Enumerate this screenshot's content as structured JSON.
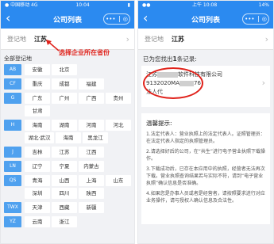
{
  "app": {
    "title": "公司列表"
  },
  "left": {
    "status": {
      "carrier": "● 中国移动 4G",
      "time": "10:04",
      "battery": "▮"
    },
    "region_label": "登记地",
    "region_value": "江苏",
    "annotation": "选择企业所在省份",
    "all_title": "全部登记地",
    "groups": [
      {
        "letter": "AB",
        "cities": [
          "安徽",
          "北京"
        ]
      },
      {
        "letter": "CF",
        "cities": [
          "重庆",
          "成都",
          "福建"
        ]
      },
      {
        "letter": "G",
        "cities": [
          "广东",
          "广州",
          "广西",
          "贵州",
          "甘肃"
        ]
      },
      {
        "letter": "H",
        "cities": [
          "海南",
          "湖南",
          "河南",
          "河北",
          "湖北·武汉",
          "海南",
          "黑龙江"
        ]
      },
      {
        "letter": "J",
        "cities": [
          "吉林",
          "江苏",
          "江西"
        ]
      },
      {
        "letter": "LN",
        "cities": [
          "辽宁",
          "宁夏",
          "内蒙古"
        ]
      },
      {
        "letter": "QS",
        "cities": [
          "青海",
          "山西",
          "上海",
          "山东",
          "深圳",
          "四川",
          "陕西"
        ]
      },
      {
        "letter": "TWX",
        "cities": [
          "天津",
          "西藏",
          "新疆"
        ]
      },
      {
        "letter": "YZ",
        "cities": [
          "云南",
          "浙江"
        ]
      }
    ]
  },
  "right": {
    "status": {
      "carrier": "●●",
      "time": "上午 10:08",
      "battery": "14%"
    },
    "region_label": "登记地",
    "region_value": "江苏",
    "results_prefix": "已为您找出",
    "results_count": "1",
    "results_suffix": "条记录:",
    "company_name_start": "江苏",
    "company_name_end": "软件科技有限公司",
    "company_code_start": "9132020MA",
    "company_code_end": "76",
    "legal_person": "法人代",
    "tips_title": "温馨提示:",
    "tips": [
      "1.法定代表人：营业执照上的法定代表人。证照管理员：在法定代表人指定的执照管理员。",
      "2.请选择好后的公司，在“共生”进行电子营业执照下载操作。",
      "3.下载成功后，已存在本应用中的执照，经营者无法再次下载。营业执照查询结果若与实际不符，请到“电子营业执照”确认信息是否准确。",
      "4.如果您是办事人员或者是经营者，请按照要求进行对应业务操作，请与授权人确认信息及合法性。"
    ]
  }
}
